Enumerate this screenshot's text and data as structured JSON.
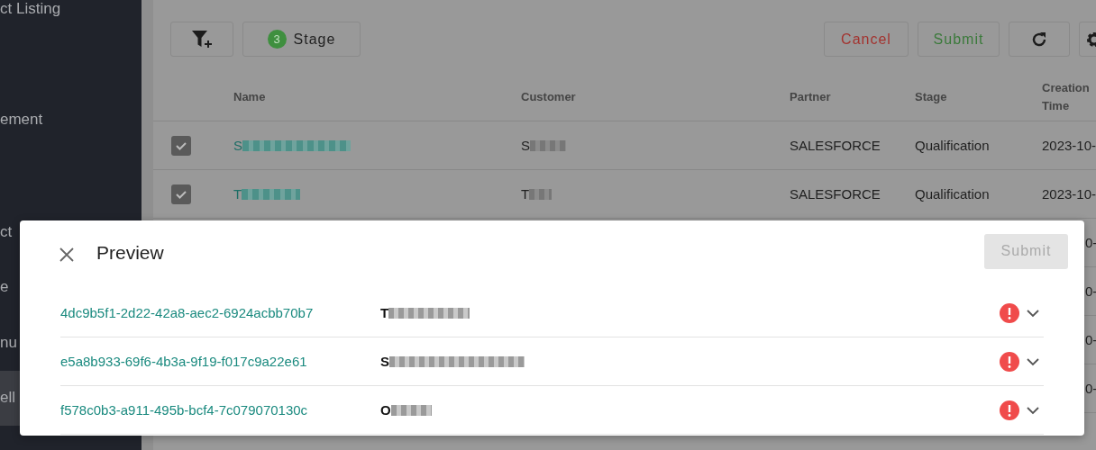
{
  "sidebar": {
    "items": [
      {
        "label": "ct Listing",
        "selected": false
      },
      {
        "label": "ement",
        "selected": false
      },
      {
        "label": "ct",
        "selected": false
      },
      {
        "label": "e",
        "selected": false
      },
      {
        "label": "nu",
        "selected": false
      },
      {
        "label": "ell",
        "selected": true
      }
    ]
  },
  "toolbar": {
    "stage_filter": {
      "count": "3",
      "label": "Stage"
    },
    "buttons": [
      {
        "label": "Cancel",
        "kind": "danger"
      },
      {
        "label": "Submit",
        "kind": "success"
      }
    ]
  },
  "table": {
    "columns": [
      "Name",
      "Customer",
      "Partner",
      "Stage",
      "Creation Time"
    ],
    "rows": [
      {
        "checked": true,
        "name": "S",
        "customer": "S",
        "partner": "SALESFORCE",
        "stage": "Qualification",
        "creation_time": "2023-10-"
      },
      {
        "checked": true,
        "name": "T",
        "customer": "T",
        "partner": "SALESFORCE",
        "stage": "Qualification",
        "creation_time": "2023-10-"
      }
    ],
    "covered_rows": [
      {
        "creation_time": "0-"
      },
      {
        "creation_time": "0-"
      },
      {
        "creation_time": "0-"
      },
      {
        "creation_time": "0-"
      }
    ]
  },
  "dialog": {
    "title": "Preview",
    "submit": {
      "label": "Submit",
      "disabled": true
    },
    "items": [
      {
        "id": "4dc9b5f1-2d22-42a8-aec2-6924acbb70b7",
        "name": "T",
        "error": true,
        "expanded": false
      },
      {
        "id": "e5a8b933-69f6-4b3a-9f19-f017c9a22e61",
        "name": "S",
        "error": true,
        "expanded": false
      },
      {
        "id": "f578c0b3-a911-495b-bcf4-7c079070130c",
        "name": "O",
        "error": true,
        "expanded": false
      }
    ]
  }
}
